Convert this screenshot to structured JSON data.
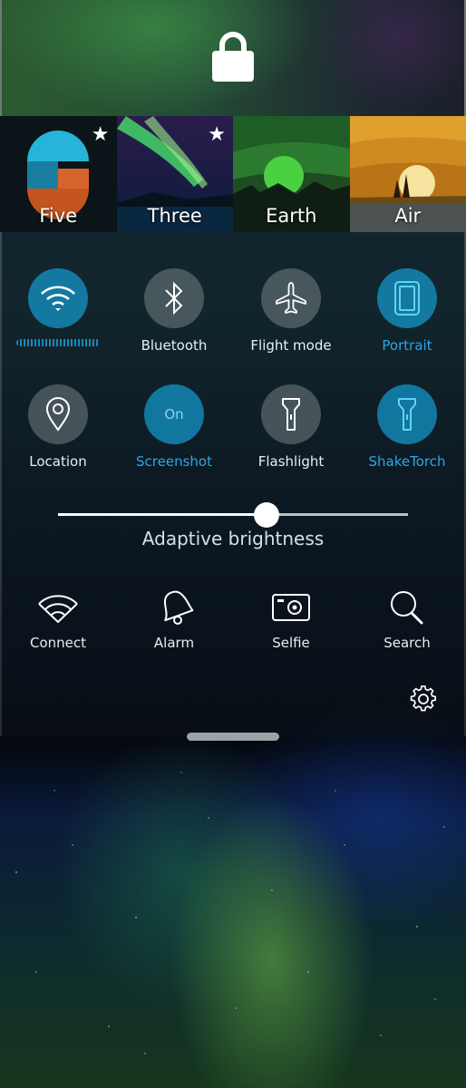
{
  "lock": {
    "icon": "lock-icon"
  },
  "ambiences": [
    {
      "name": "Five",
      "favorite": true
    },
    {
      "name": "Three",
      "favorite": true
    },
    {
      "name": "Earth",
      "favorite": false
    },
    {
      "name": "Air",
      "favorite": false
    }
  ],
  "toggles": [
    {
      "label": "",
      "icon": "wifi-icon",
      "state": "on"
    },
    {
      "label": "Bluetooth",
      "icon": "bluetooth-icon",
      "state": "off"
    },
    {
      "label": "Flight mode",
      "icon": "airplane-icon",
      "state": "off"
    },
    {
      "label": "Portrait",
      "icon": "portrait-icon",
      "state": "on"
    },
    {
      "label": "Location",
      "icon": "location-pin-icon",
      "state": "off"
    },
    {
      "label": "Screenshot",
      "icon": "screenshot-icon",
      "state": "on",
      "circle_text": "On"
    },
    {
      "label": "Flashlight",
      "icon": "flashlight-icon",
      "state": "off"
    },
    {
      "label": "ShakeTorch",
      "icon": "shaketorch-icon",
      "state": "on"
    }
  ],
  "brightness": {
    "label": "Adaptive brightness",
    "level": 0.595
  },
  "shortcuts": [
    {
      "label": "Connect",
      "icon": "wifi-connect-icon"
    },
    {
      "label": "Alarm",
      "icon": "alarm-bell-icon"
    },
    {
      "label": "Selfie",
      "icon": "camera-icon"
    },
    {
      "label": "Search",
      "icon": "search-icon"
    }
  ],
  "colors": {
    "accent": "#2aa8e4",
    "toggle_on": "#1496c8"
  }
}
